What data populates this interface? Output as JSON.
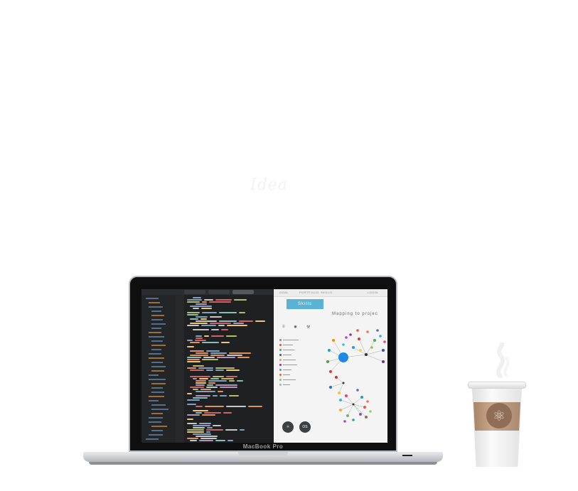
{
  "page": {
    "faint_title": "Idea"
  },
  "laptop": {
    "brand": "MacBook Pro",
    "app": {
      "nav": [
        "GOAL",
        "PORTFOLIO",
        "SKILLS",
        "LOGIN"
      ],
      "skills_button": "Skills",
      "mapping_title": "Mapping to projec",
      "circle_buttons": [
        "",
        "OS"
      ]
    }
  },
  "colors": {
    "accent": "#5ab3d4",
    "editor_bg": "#1e2022",
    "sleeve": "#b3957a"
  },
  "icons": [
    "gear-icon",
    "wrench-icon",
    "atom-icon",
    "coffee-cup"
  ]
}
